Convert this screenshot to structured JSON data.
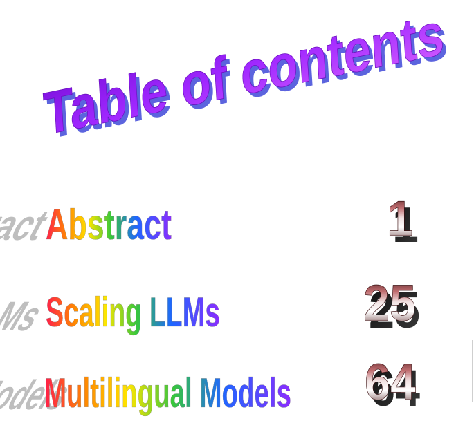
{
  "title": "Table of contents",
  "entries": [
    {
      "label": "Abstract",
      "page": "1"
    },
    {
      "label": "Scaling LLMs",
      "page": "25"
    },
    {
      "label": "Multilingual Models",
      "page": "64"
    }
  ],
  "colors": {
    "title_purple": "#8a18e8",
    "title_magenta": "#c83cff",
    "title_shadow": "#2f39d6",
    "rainbow_red": "#ff1f4a",
    "rainbow_orange": "#ff8a00",
    "rainbow_yellow": "#ffe600",
    "rainbow_green": "#38c83a",
    "rainbow_blue": "#1e67ff",
    "rainbow_violet": "#8b2cff",
    "number_dark": "#3a0f10",
    "number_rose": "#c06d70",
    "number_light": "#f1e2e2"
  }
}
